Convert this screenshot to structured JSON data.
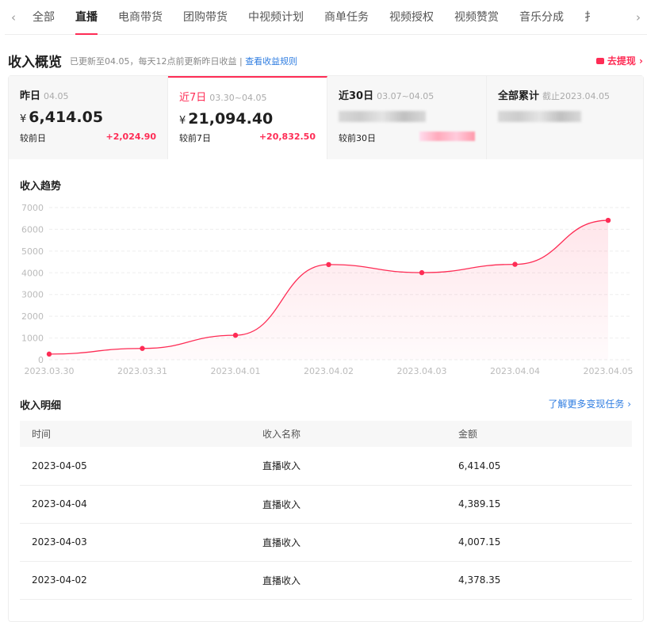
{
  "tabs": [
    "全部",
    "直播",
    "电商带货",
    "团购带货",
    "中视频计划",
    "商单任务",
    "视频授权",
    "视频赞赏",
    "音乐分成",
    "扌"
  ],
  "active_tab": 1,
  "overview": {
    "title": "收入概览",
    "subtitle": "已更新至04.05，每天12点前更新昨日收益 | ",
    "rules_link": "查看收益规则",
    "withdraw": "去提现 ›"
  },
  "cards": [
    {
      "label": "昨日",
      "date": "04.05",
      "currency": "¥",
      "value": "6,414.05",
      "compare": "较前日",
      "delta": "+2,024.90"
    },
    {
      "label": "近7日",
      "date": "03.30~04.05",
      "currency": "¥",
      "value": "21,094.40",
      "compare": "较前7日",
      "delta": "+20,832.50"
    },
    {
      "label": "近30日",
      "date": "03.07~04.05",
      "compare": "较前30日"
    },
    {
      "label": "全部累计",
      "date": "截止2023.04.05"
    }
  ],
  "trend_title": "收入趋势",
  "chart_data": {
    "type": "area",
    "x": [
      "2023.03.30",
      "2023.03.31",
      "2023.04.01",
      "2023.04.02",
      "2023.04.03",
      "2023.04.04",
      "2023.04.05"
    ],
    "values": [
      260,
      520,
      1126,
      4378.35,
      4007.15,
      4389.15,
      6414.05
    ],
    "ylim": [
      0,
      7000
    ],
    "yticks": [
      0,
      1000,
      2000,
      3000,
      4000,
      5000,
      6000,
      7000
    ],
    "grid": true,
    "color": "#fe2c55"
  },
  "detail": {
    "title": "收入明细",
    "more": "了解更多变现任务 ›",
    "headers": [
      "时间",
      "收入名称",
      "金额"
    ],
    "rows": [
      [
        "2023-04-05",
        "直播收入",
        "6,414.05"
      ],
      [
        "2023-04-04",
        "直播收入",
        "4,389.15"
      ],
      [
        "2023-04-03",
        "直播收入",
        "4,007.15"
      ],
      [
        "2023-04-02",
        "直播收入",
        "4,378.35"
      ]
    ]
  },
  "colors": {
    "accent": "#fe2c55",
    "link": "#2f7de1"
  }
}
